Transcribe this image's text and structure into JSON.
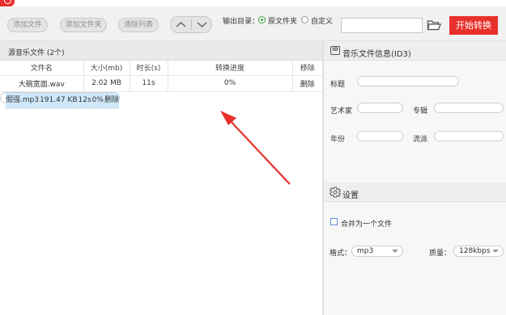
{
  "toolbar": {
    "add_file": "添加文件",
    "add_folder": "添加文件夹",
    "clear_list": "清除列表",
    "output_dir_label": "输出目录：",
    "option_source_folder": "原文件夹",
    "option_custom": "自定义",
    "path_value": "",
    "start_button": "开始转换"
  },
  "file_list": {
    "title": "源音乐文件 (2个)",
    "columns": [
      "文件名",
      "大小(mb)",
      "时长(s)",
      "转换进度",
      "移除"
    ],
    "rows": [
      {
        "name": "大碗宽面.wav",
        "size": "2.02 MB",
        "duration": "11s",
        "progress": "0%",
        "remove": "删除"
      },
      {
        "name": "倔强.mp3",
        "size": "191.47 KB",
        "duration": "12s",
        "progress": "0%",
        "remove": "删除"
      }
    ],
    "selected_row": 1
  },
  "id3": {
    "title": "音乐文件信息(ID3)",
    "icon_text": "ID",
    "fields": {
      "title_label": "标题",
      "artist_label": "艺术家",
      "album_label": "专辑",
      "year_label": "年份",
      "genre_label": "流派"
    }
  },
  "settings": {
    "title": "设置",
    "merge_label": "合并为一个文件",
    "format_label": "格式：",
    "format_value": "mp3",
    "quality_label": "质量：",
    "quality_value": "128kbps"
  },
  "colors": {
    "accent_red": "#e8302c",
    "selected_row": "#cde8fa"
  }
}
